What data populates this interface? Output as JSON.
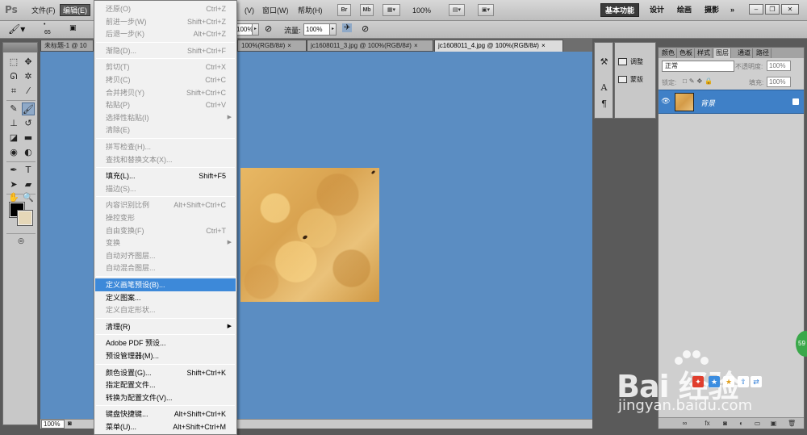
{
  "app": {
    "logo": "Ps"
  },
  "menubar": {
    "items": [
      "文件(F)",
      "编辑(E)"
    ],
    "view_item": "(V)",
    "window_item": "窗口(W)",
    "help_item": "帮助(H)",
    "br_icon": "Br",
    "mb_icon": "Mb",
    "zoom": "100%",
    "workspaces": [
      "基本功能",
      "设计",
      "绘画",
      "摄影"
    ],
    "more": "»"
  },
  "options": {
    "brush_size": "65",
    "field1": "100%",
    "flow_label": "流量:",
    "flow_value": "100%"
  },
  "tabs": [
    {
      "label": "未标题-1 @ 10",
      "active": false
    },
    {
      "label": "100%(RGB/8#)",
      "active": false
    },
    {
      "label": "jc1608011_3.jpg @ 100%(RGB/8#)",
      "active": false
    },
    {
      "label": "jc1608011_4.jpg @ 100%(RGB/8#)",
      "active": true
    }
  ],
  "status": {
    "zoom": "100%"
  },
  "adjust_panel": {
    "adjust_label": "调整",
    "mask_label": "蒙版"
  },
  "layers_panel": {
    "tabs": [
      "颜色",
      "色板",
      "样式",
      "图层",
      "通道",
      "路径"
    ],
    "active_tab": "图层",
    "blend_mode": "正常",
    "opacity_label": "不透明度:",
    "opacity_value": "100%",
    "lock_label": "锁定:",
    "fill_label": "填充:",
    "fill_value": "100%",
    "layer_name": "背景"
  },
  "edit_menu": [
    {
      "label": "还原(O)",
      "shortcut": "Ctrl+Z",
      "disabled": true
    },
    {
      "label": "前进一步(W)",
      "shortcut": "Shift+Ctrl+Z",
      "disabled": true
    },
    {
      "label": "后退一步(K)",
      "shortcut": "Alt+Ctrl+Z",
      "disabled": true
    },
    {
      "sep": true
    },
    {
      "label": "渐隐(D)...",
      "shortcut": "Shift+Ctrl+F",
      "disabled": true
    },
    {
      "sep": true
    },
    {
      "label": "剪切(T)",
      "shortcut": "Ctrl+X",
      "disabled": true
    },
    {
      "label": "拷贝(C)",
      "shortcut": "Ctrl+C",
      "disabled": true
    },
    {
      "label": "合并拷贝(Y)",
      "shortcut": "Shift+Ctrl+C",
      "disabled": true
    },
    {
      "label": "粘贴(P)",
      "shortcut": "Ctrl+V",
      "disabled": true
    },
    {
      "label": "选择性粘贴(I)",
      "shortcut": "",
      "disabled": true,
      "submenu": true
    },
    {
      "label": "清除(E)",
      "shortcut": "",
      "disabled": true
    },
    {
      "sep": true
    },
    {
      "label": "拼写检查(H)...",
      "shortcut": "",
      "disabled": true
    },
    {
      "label": "查找和替换文本(X)...",
      "shortcut": "",
      "disabled": true
    },
    {
      "sep": true
    },
    {
      "label": "填充(L)...",
      "shortcut": "Shift+F5",
      "disabled": false
    },
    {
      "label": "描边(S)...",
      "shortcut": "",
      "disabled": true
    },
    {
      "sep": true
    },
    {
      "label": "内容识别比例",
      "shortcut": "Alt+Shift+Ctrl+C",
      "disabled": true
    },
    {
      "label": "操控变形",
      "shortcut": "",
      "disabled": true
    },
    {
      "label": "自由变换(F)",
      "shortcut": "Ctrl+T",
      "disabled": true
    },
    {
      "label": "变换",
      "shortcut": "",
      "disabled": true,
      "submenu": true
    },
    {
      "label": "自动对齐图层...",
      "shortcut": "",
      "disabled": true
    },
    {
      "label": "自动混合图层...",
      "shortcut": "",
      "disabled": true
    },
    {
      "sep": true
    },
    {
      "label": "定义画笔预设(B)...",
      "shortcut": "",
      "disabled": false,
      "highlighted": true
    },
    {
      "label": "定义图案...",
      "shortcut": "",
      "disabled": false
    },
    {
      "label": "定义自定形状...",
      "shortcut": "",
      "disabled": true
    },
    {
      "sep": true
    },
    {
      "label": "清理(R)",
      "shortcut": "",
      "disabled": false,
      "submenu": true
    },
    {
      "sep": true
    },
    {
      "label": "Adobe PDF 预设...",
      "shortcut": "",
      "disabled": false
    },
    {
      "label": "预设管理器(M)...",
      "shortcut": "",
      "disabled": false
    },
    {
      "sep": true
    },
    {
      "label": "颜色设置(G)...",
      "shortcut": "Shift+Ctrl+K",
      "disabled": false
    },
    {
      "label": "指定配置文件...",
      "shortcut": "",
      "disabled": false
    },
    {
      "label": "转换为配置文件(V)...",
      "shortcut": "",
      "disabled": false
    },
    {
      "sep": true
    },
    {
      "label": "键盘快捷键...",
      "shortcut": "Alt+Shift+Ctrl+K",
      "disabled": false
    },
    {
      "label": "菜单(U)...",
      "shortcut": "Alt+Shift+Ctrl+M",
      "disabled": false
    }
  ],
  "watermark": {
    "logo": "Bai 经验",
    "url": "jingyan.baidu.com",
    "bubble": "59"
  }
}
